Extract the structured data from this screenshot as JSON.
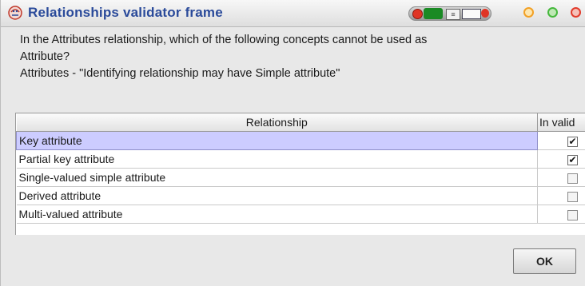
{
  "window": {
    "title": "Relationships validator frame",
    "title_color": "#2a4a9a",
    "icon": "app-icon"
  },
  "question": {
    "line1": "In the Attributes relationship, which of the following concepts cannot be used as",
    "line2": "Attribute?",
    "line3": "Attributes - \"Identifying relationship may have Simple attribute\""
  },
  "table": {
    "columns": [
      "Relationship",
      "In valid"
    ],
    "rows": [
      {
        "label": "Key attribute",
        "invalid": true,
        "selected": true
      },
      {
        "label": "Partial key attribute",
        "invalid": true,
        "selected": false
      },
      {
        "label": "Single-valued simple  attribute",
        "invalid": false,
        "selected": false
      },
      {
        "label": "Derived attribute",
        "invalid": false,
        "selected": false
      },
      {
        "label": "Multi-valued attribute",
        "invalid": false,
        "selected": false
      }
    ],
    "selection_color": "#ccccff"
  },
  "footer": {
    "ok_label": "OK"
  },
  "check_mark": "✔"
}
